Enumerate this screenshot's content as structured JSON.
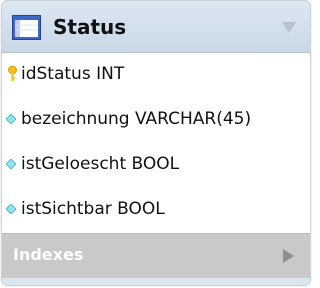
{
  "table": {
    "title": "Status",
    "icon": "table-icon",
    "collapse_icon": "triangle-down-icon"
  },
  "columns": [
    {
      "text": "idStatus INT",
      "icon": "primary-key-icon"
    },
    {
      "text": "bezeichnung VARCHAR(45)",
      "icon": "column-diamond-icon"
    },
    {
      "text": "istGeloescht BOOL",
      "icon": "column-diamond-icon"
    },
    {
      "text": "istSichtbar BOOL",
      "icon": "column-diamond-icon"
    }
  ],
  "indexes": {
    "label": "Indexes",
    "expand_icon": "triangle-right-icon"
  }
}
